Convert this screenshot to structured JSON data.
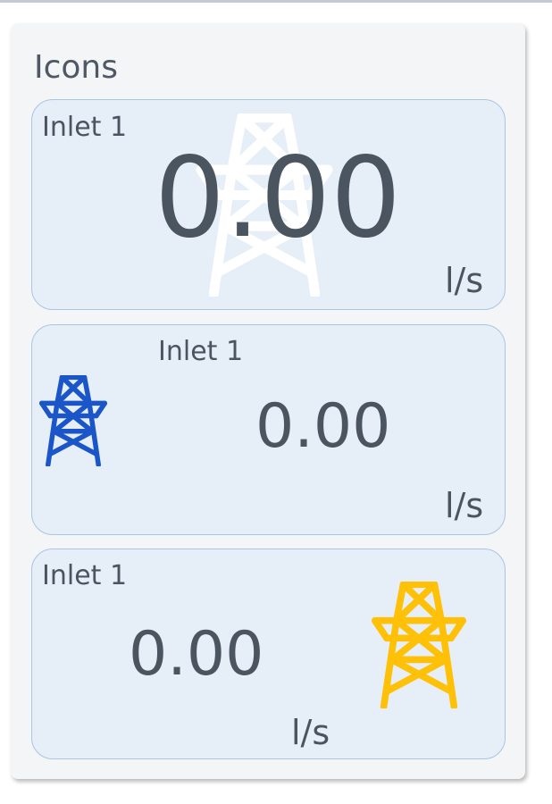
{
  "panel": {
    "title": "Icons"
  },
  "cards": [
    {
      "label": "Inlet 1",
      "value": "0.00",
      "unit": "l/s",
      "icon": "transmission-tower-icon",
      "icon_color": "#ffffff"
    },
    {
      "label": "Inlet 1",
      "value": "0.00",
      "unit": "l/s",
      "icon": "transmission-tower-icon",
      "icon_color": "#1a56c8"
    },
    {
      "label": "Inlet 1",
      "value": "0.00",
      "unit": "l/s",
      "icon": "transmission-tower-icon",
      "icon_color": "#ffc107"
    }
  ],
  "colors": {
    "panel_bg": "#f4f5f7",
    "card_bg": "#e6eef8",
    "card_border": "#a9c4e4",
    "text": "#4b5560"
  }
}
